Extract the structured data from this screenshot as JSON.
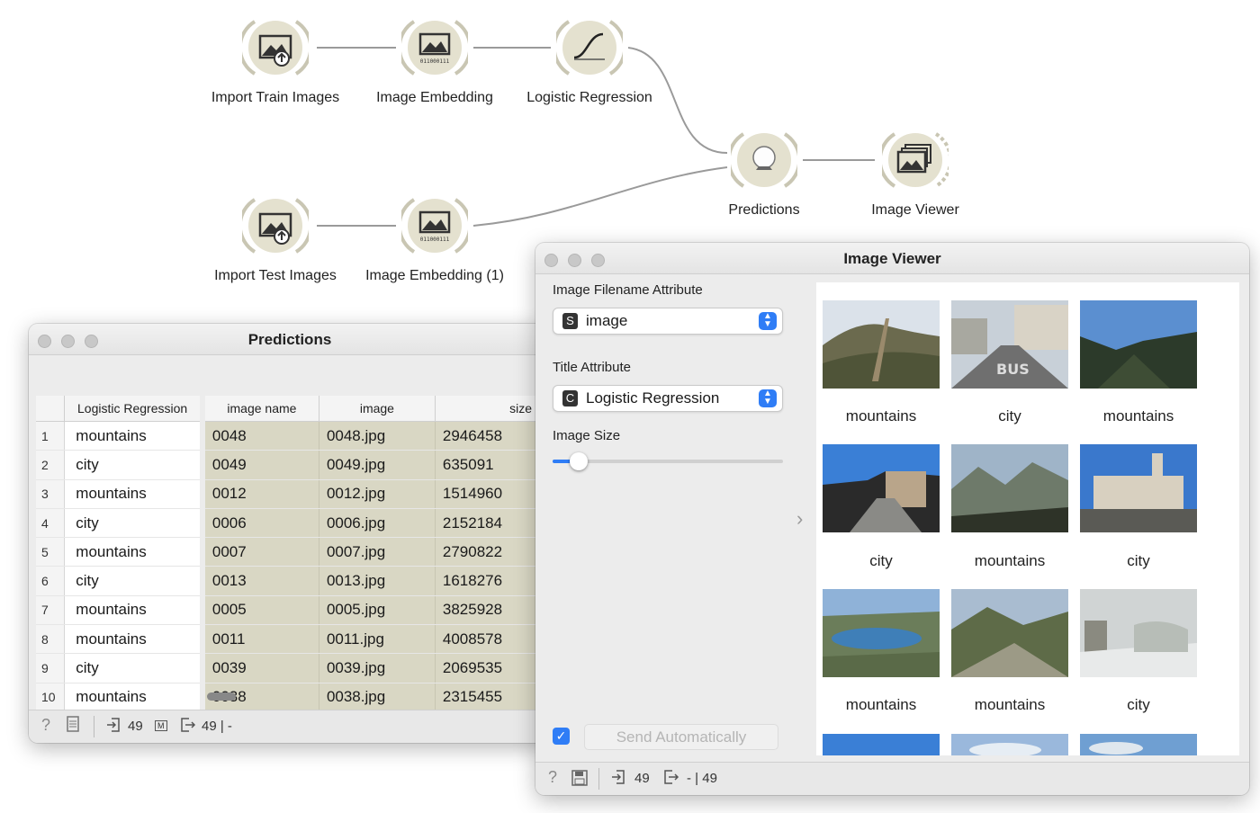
{
  "workflow": {
    "nodes": [
      {
        "label": "Import Train Images",
        "icon": "image-upload-icon"
      },
      {
        "label": "Image Embedding",
        "icon": "image-embedding-icon"
      },
      {
        "label": "Logistic Regression",
        "icon": "sigmoid-curve-icon"
      },
      {
        "label": "Predictions",
        "icon": "crystal-ball-icon"
      },
      {
        "label": "Image Viewer",
        "icon": "image-stack-icon"
      },
      {
        "label": "Import Test Images",
        "icon": "image-upload-icon"
      },
      {
        "label": "Image Embedding (1)",
        "icon": "image-embedding-icon"
      }
    ],
    "embedding_bits": "011000111"
  },
  "predictions_window": {
    "title": "Predictions",
    "columns": [
      "Logistic Regression",
      "image name",
      "image",
      "size"
    ],
    "rows": [
      {
        "n": "1",
        "pred": "mountains",
        "name": "0048",
        "image": "0048.jpg",
        "size": "2946458"
      },
      {
        "n": "2",
        "pred": "city",
        "name": "0049",
        "image": "0049.jpg",
        "size": "635091"
      },
      {
        "n": "3",
        "pred": "mountains",
        "name": "0012",
        "image": "0012.jpg",
        "size": "1514960"
      },
      {
        "n": "4",
        "pred": "city",
        "name": "0006",
        "image": "0006.jpg",
        "size": "2152184"
      },
      {
        "n": "5",
        "pred": "mountains",
        "name": "0007",
        "image": "0007.jpg",
        "size": "2790822"
      },
      {
        "n": "6",
        "pred": "city",
        "name": "0013",
        "image": "0013.jpg",
        "size": "1618276"
      },
      {
        "n": "7",
        "pred": "mountains",
        "name": "0005",
        "image": "0005.jpg",
        "size": "3825928"
      },
      {
        "n": "8",
        "pred": "mountains",
        "name": "0011",
        "image": "0011.jpg",
        "size": "4008578"
      },
      {
        "n": "9",
        "pred": "city",
        "name": "0039",
        "image": "0039.jpg",
        "size": "2069535"
      },
      {
        "n": "10",
        "pred": "mountains",
        "name": "0038",
        "image": "0038.jpg",
        "size": "2315455"
      }
    ],
    "status": {
      "input": "49",
      "input_badge": "M",
      "output": "49 | -"
    }
  },
  "viewer_window": {
    "title": "Image Viewer",
    "filename_label": "Image Filename Attribute",
    "filename_badge": "S",
    "filename_value": "image",
    "title_label": "Title Attribute",
    "title_badge": "C",
    "title_value": "Logistic Regression",
    "size_label": "Image Size",
    "size_level": 0.08,
    "send_auto_label": "Send Automatically",
    "send_auto_checked": true,
    "captions": [
      "mountains",
      "city",
      "mountains",
      "city",
      "mountains",
      "city",
      "mountains",
      "mountains",
      "city"
    ],
    "status": {
      "input": "49",
      "output": "- | 49"
    }
  },
  "colors": {
    "accent": "#2f7df6",
    "node_fill": "#e4e1cf",
    "tan_cells": "#d9d7c4"
  }
}
